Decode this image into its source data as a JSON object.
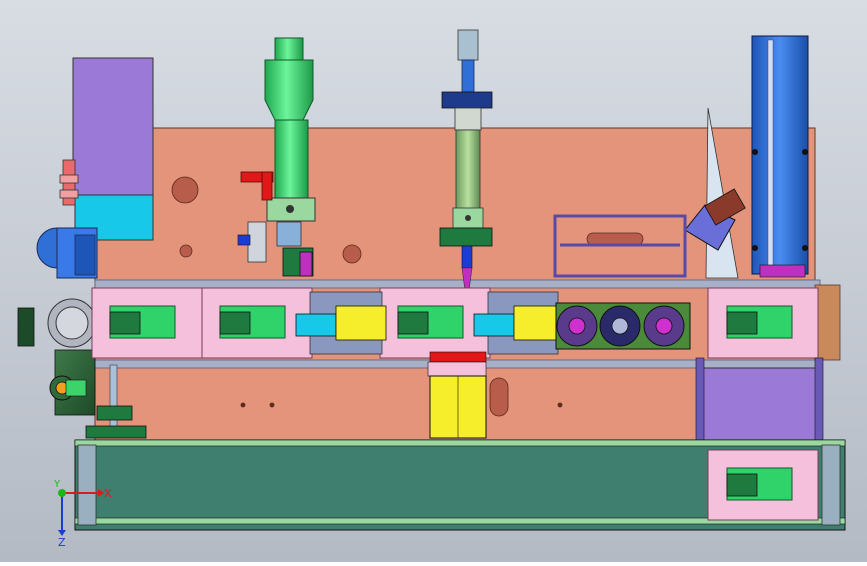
{
  "viewport": {
    "background_top": "#d8dde4",
    "background_bottom": "#b4bac4"
  },
  "triad": {
    "x_label": "X",
    "y_label": "Y",
    "z_label": "Z",
    "x_color": "#e01818",
    "y_color": "#18b818",
    "z_color": "#1c3cd8"
  },
  "colors": {
    "base_plate": "#e3947a",
    "base_outline": "#5a3a2a",
    "pink_fixture": "#f4c0dc",
    "green_part": "#2fd36a",
    "dark_green_part": "#1e7a3e",
    "cylinder_green": "#3fe07a",
    "blue_column": "#2f6fd6",
    "purple_block": "#9a7ad6",
    "cyan_block": "#18c8e8",
    "yellow_block": "#f6ee2a",
    "conveyor_fill": "#3e7f70",
    "magenta_wheel": "#d030d0",
    "rail_gray": "#a8b0c8"
  }
}
